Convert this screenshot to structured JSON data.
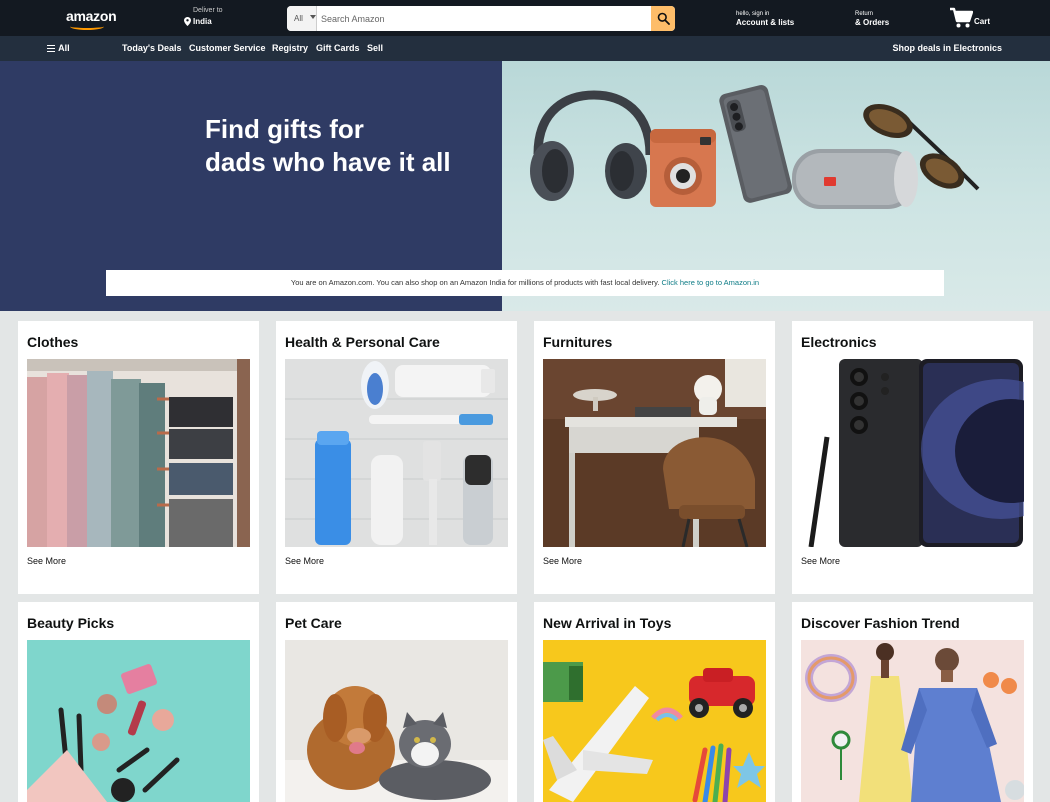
{
  "header": {
    "logo": "amazon",
    "deliver_label": "Deliver to",
    "deliver_location": "India",
    "search": {
      "category": "All",
      "placeholder": "Search Amazon",
      "value": ""
    },
    "account_line1": "hello, sign in",
    "account_line2": "Account & lists",
    "returns_line1": "Return",
    "returns_line2": "& Orders",
    "cart_label": "Cart"
  },
  "subnav": {
    "all_label": "All",
    "items": [
      "Today's Deals",
      "Customer Service",
      "Registry",
      "Gift Cards",
      "Sell"
    ],
    "promo": "Shop deals in Electronics"
  },
  "hero": {
    "title_line1": "Find gifts for",
    "title_line2": "dads who have it all",
    "notice_text": "You are on Amazon.com. You can also shop on an Amazon India for millions of products with fast local delivery.",
    "notice_link": "Click here to go to Amazon.in"
  },
  "cards": [
    {
      "title": "Clothes",
      "link": "See More"
    },
    {
      "title": "Health & Personal Care",
      "link": "See More"
    },
    {
      "title": "Furnitures",
      "link": "See More"
    },
    {
      "title": "Electronics",
      "link": "See More"
    },
    {
      "title": "Beauty Picks",
      "link": ""
    },
    {
      "title": "Pet Care",
      "link": ""
    },
    {
      "title": "New Arrival in Toys",
      "link": ""
    },
    {
      "title": "Discover Fashion Trend",
      "link": ""
    }
  ],
  "colors": {
    "nav_top": "#131921",
    "nav_sub": "#232f3e",
    "accent": "#febd69",
    "hero_left": "#2f3b64",
    "page_bg": "#e3e6e6"
  }
}
